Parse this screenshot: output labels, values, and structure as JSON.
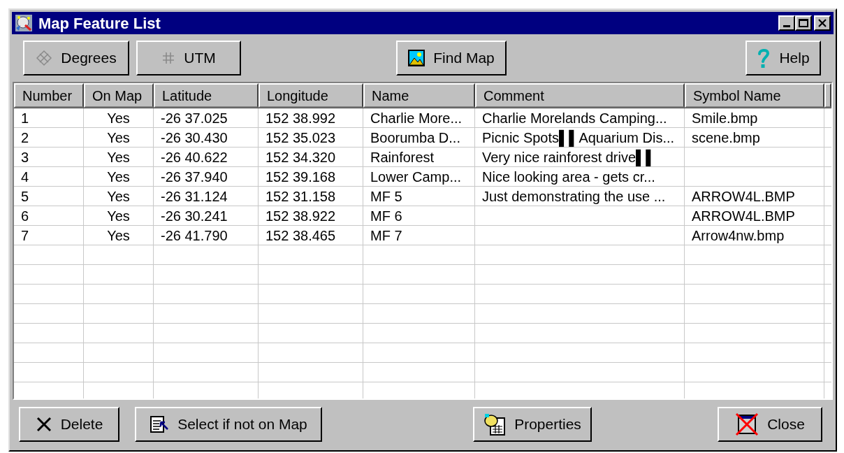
{
  "window": {
    "title": "Map Feature List"
  },
  "toolbar": [
    {
      "kind": "degrees",
      "label": "Degrees"
    },
    {
      "kind": "utm",
      "label": "UTM"
    },
    {
      "kind": "findmap",
      "label": "Find Map"
    },
    {
      "kind": "help",
      "label": "Help"
    }
  ],
  "table": {
    "columns": [
      "Number",
      "On Map",
      "Latitude",
      "Longitude",
      "Name",
      "Comment",
      "Symbol Name"
    ],
    "rows": [
      [
        "1",
        "Yes",
        "-26 37.025",
        "152 38.992",
        "Charlie More...",
        "Charlie Morelands Camping...",
        "Smile.bmp"
      ],
      [
        "2",
        "Yes",
        "-26 30.430",
        "152 35.023",
        "Boorumba D...",
        "Picnic Spots▌▌Aquarium Dis...",
        "scene.bmp"
      ],
      [
        "3",
        "Yes",
        "-26 40.622",
        "152 34.320",
        "Rainforest",
        "Very nice rainforest drive▌▌",
        null
      ],
      [
        "4",
        "Yes",
        "-26 37.940",
        "152 39.168",
        "Lower Camp...",
        "Nice looking area - gets cr...",
        null
      ],
      [
        "5",
        "Yes",
        "-26 31.124",
        "152 31.158",
        "MF 5",
        "Just demonstrating the use ...",
        "ARROW4L.BMP"
      ],
      [
        "6",
        "Yes",
        "-26 30.241",
        "152 38.922",
        "MF 6",
        null,
        "ARROW4L.BMP"
      ],
      [
        "7",
        "Yes",
        "-26 41.790",
        "152 38.465",
        "MF 7",
        null,
        "Arrow4nw.bmp"
      ]
    ]
  },
  "footer": [
    {
      "kind": "delete",
      "label": "Delete"
    },
    {
      "kind": "select",
      "label": "Select if not on Map"
    },
    {
      "kind": "properties",
      "label": "Properties"
    },
    {
      "kind": "close",
      "label": "Close"
    }
  ]
}
